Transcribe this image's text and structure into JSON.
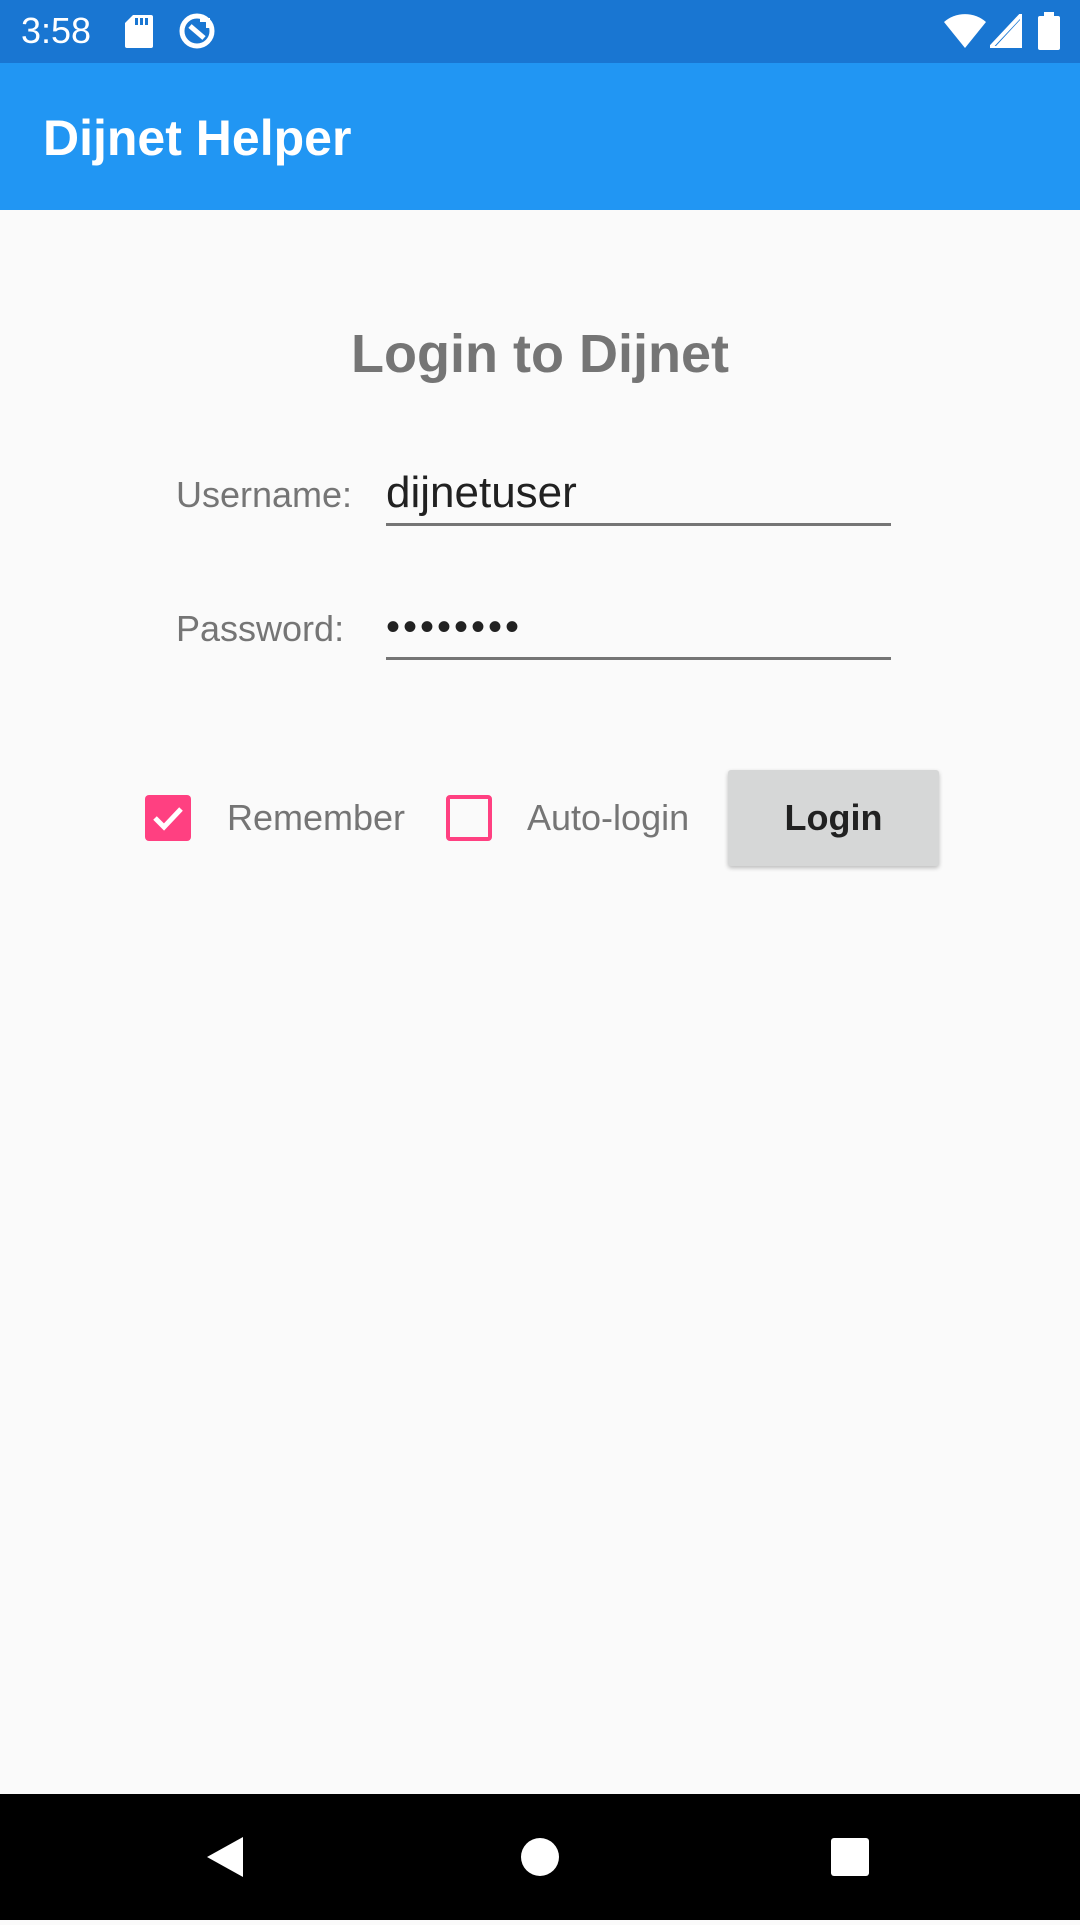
{
  "status_bar": {
    "time": "3:58",
    "icons": [
      "sd-card-icon",
      "sync-icon",
      "wifi-icon",
      "signal-icon",
      "battery-icon"
    ]
  },
  "app_bar": {
    "title": "Dijnet Helper",
    "color": "#2196f3"
  },
  "login": {
    "title": "Login to Dijnet",
    "username_label": "Username:",
    "username_value": "dijnetuser",
    "password_label": "Password:",
    "password_value": "••••••••",
    "remember_label": "Remember",
    "remember_checked": true,
    "autologin_label": "Auto-login",
    "autologin_checked": false,
    "login_button": "Login",
    "accent_color": "#ff4081"
  },
  "nav_bar": {
    "icons": [
      "back-icon",
      "home-icon",
      "recents-icon"
    ]
  }
}
